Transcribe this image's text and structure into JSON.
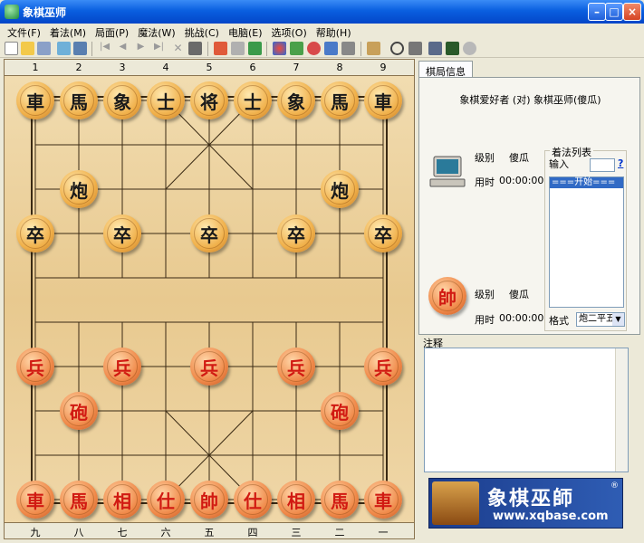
{
  "window": {
    "title": "象棋巫师"
  },
  "menu": [
    "文件(F)",
    "着法(M)",
    "局面(P)",
    "魔法(W)",
    "挑战(C)",
    "电脑(E)",
    "选项(O)",
    "帮助(H)"
  ],
  "board": {
    "top_coords": [
      "1",
      "2",
      "3",
      "4",
      "5",
      "6",
      "7",
      "8",
      "9"
    ],
    "bottom_coords": [
      "九",
      "八",
      "七",
      "六",
      "五",
      "四",
      "三",
      "二",
      "一"
    ],
    "pieces": [
      {
        "label": "車",
        "side": "black",
        "file": 0,
        "rank": 0
      },
      {
        "label": "馬",
        "side": "black",
        "file": 1,
        "rank": 0
      },
      {
        "label": "象",
        "side": "black",
        "file": 2,
        "rank": 0
      },
      {
        "label": "士",
        "side": "black",
        "file": 3,
        "rank": 0
      },
      {
        "label": "将",
        "side": "black",
        "file": 4,
        "rank": 0
      },
      {
        "label": "士",
        "side": "black",
        "file": 5,
        "rank": 0
      },
      {
        "label": "象",
        "side": "black",
        "file": 6,
        "rank": 0
      },
      {
        "label": "馬",
        "side": "black",
        "file": 7,
        "rank": 0
      },
      {
        "label": "車",
        "side": "black",
        "file": 8,
        "rank": 0
      },
      {
        "label": "炮",
        "side": "black",
        "file": 1,
        "rank": 2
      },
      {
        "label": "炮",
        "side": "black",
        "file": 7,
        "rank": 2
      },
      {
        "label": "卒",
        "side": "black",
        "file": 0,
        "rank": 3
      },
      {
        "label": "卒",
        "side": "black",
        "file": 2,
        "rank": 3
      },
      {
        "label": "卒",
        "side": "black",
        "file": 4,
        "rank": 3
      },
      {
        "label": "卒",
        "side": "black",
        "file": 6,
        "rank": 3
      },
      {
        "label": "卒",
        "side": "black",
        "file": 8,
        "rank": 3
      },
      {
        "label": "兵",
        "side": "red",
        "file": 0,
        "rank": 6
      },
      {
        "label": "兵",
        "side": "red",
        "file": 2,
        "rank": 6
      },
      {
        "label": "兵",
        "side": "red",
        "file": 4,
        "rank": 6
      },
      {
        "label": "兵",
        "side": "red",
        "file": 6,
        "rank": 6
      },
      {
        "label": "兵",
        "side": "red",
        "file": 8,
        "rank": 6
      },
      {
        "label": "砲",
        "side": "red",
        "file": 1,
        "rank": 7
      },
      {
        "label": "砲",
        "side": "red",
        "file": 7,
        "rank": 7
      },
      {
        "label": "車",
        "side": "red",
        "file": 0,
        "rank": 9
      },
      {
        "label": "馬",
        "side": "red",
        "file": 1,
        "rank": 9
      },
      {
        "label": "相",
        "side": "red",
        "file": 2,
        "rank": 9
      },
      {
        "label": "仕",
        "side": "red",
        "file": 3,
        "rank": 9
      },
      {
        "label": "帥",
        "side": "red",
        "file": 4,
        "rank": 9
      },
      {
        "label": "仕",
        "side": "red",
        "file": 5,
        "rank": 9
      },
      {
        "label": "相",
        "side": "red",
        "file": 6,
        "rank": 9
      },
      {
        "label": "馬",
        "side": "red",
        "file": 7,
        "rank": 9
      },
      {
        "label": "車",
        "side": "red",
        "file": 8,
        "rank": 9
      }
    ]
  },
  "panel": {
    "tab_label": "棋局信息",
    "matchup": "象棋爱好者 (对) 象棋巫师(傻瓜)",
    "black_level_label": "级别",
    "black_level": "傻瓜",
    "black_time_label": "用时",
    "black_time": "00:00:00",
    "red_piece": "帥",
    "red_level_label": "级别",
    "red_level": "傻瓜",
    "red_time_label": "用时",
    "red_time": "00:00:00",
    "move_list_title": "着法列表",
    "input_label": "输入",
    "help_label": "?",
    "moves": [
      "===开始==="
    ],
    "format_label": "格式",
    "format_value": "炮二平五"
  },
  "notes": {
    "label": "注释"
  },
  "banner": {
    "name": "象棋巫師",
    "url": "www.xqbase.com",
    "reg": "®"
  }
}
